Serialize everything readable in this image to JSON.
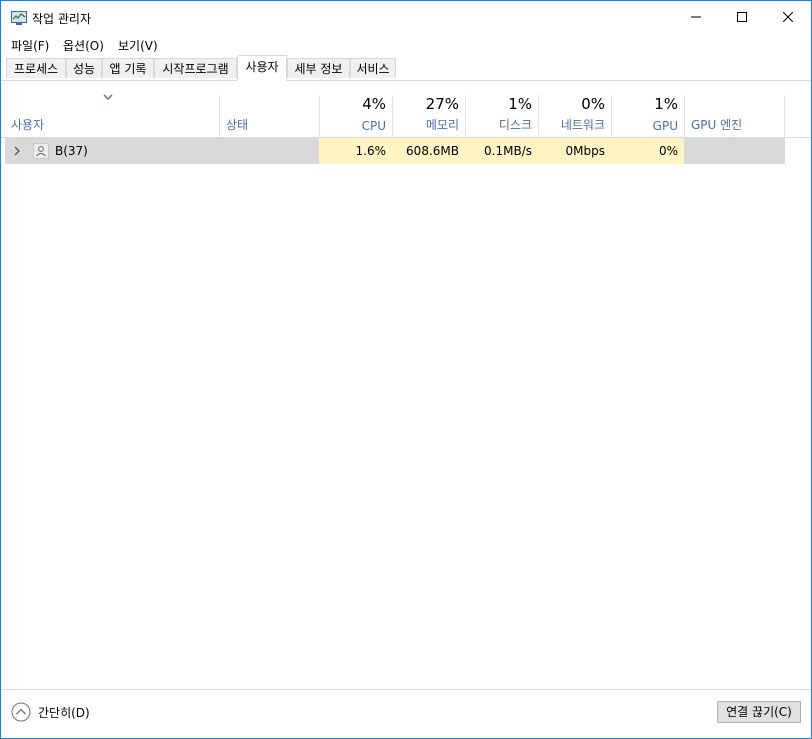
{
  "window": {
    "title": "작업 관리자"
  },
  "menu": [
    "파일(F)",
    "옵션(O)",
    "보기(V)"
  ],
  "tabs": [
    "프로세스",
    "성능",
    "앱 기록",
    "시작프로그램",
    "사용자",
    "세부 정보",
    "서비스"
  ],
  "active_tab": "사용자",
  "columns": {
    "user": "사용자",
    "status": "상태",
    "cpu": {
      "pct": "4%",
      "label": "CPU"
    },
    "memory": {
      "pct": "27%",
      "label": "메모리"
    },
    "disk": {
      "pct": "1%",
      "label": "디스크"
    },
    "network": {
      "pct": "0%",
      "label": "네트워크"
    },
    "gpu": {
      "pct": "1%",
      "label": "GPU"
    },
    "gpu_engine": "GPU 엔진"
  },
  "rows": [
    {
      "user": "B(37)",
      "status": "",
      "cpu": "1.6%",
      "memory": "608.6MB",
      "disk": "0.1MB/s",
      "network": "0Mbps",
      "gpu": "0%",
      "gpu_engine": ""
    }
  ],
  "footer": {
    "fewer_details": "간단히(D)",
    "disconnect": "연결 끊기(C)"
  },
  "colors": {
    "accent": "#1883d7",
    "header_label": "#4c6ea8",
    "cell_highlight": "#fff4c4",
    "row_selected": "#d9d9d9"
  }
}
